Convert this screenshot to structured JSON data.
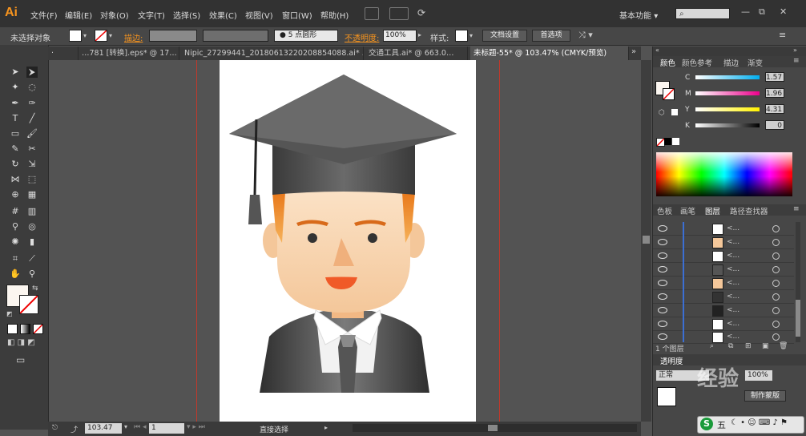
{
  "app": {
    "logo": "Ai"
  },
  "menu": [
    "文件(F)",
    "编辑(E)",
    "对象(O)",
    "文字(T)",
    "选择(S)",
    "效果(C)",
    "视图(V)",
    "窗口(W)",
    "帮助(H)"
  ],
  "workspace": {
    "label": "基本功能",
    "chevron": "▾"
  },
  "search": {
    "placeholder": ""
  },
  "window": {
    "minimize": "—",
    "restore": "⧉",
    "close": "✕"
  },
  "control": {
    "no_selection": "未选择对象",
    "stroke_label": "描边:",
    "stroke_weight": "",
    "brush": "5 点圆形",
    "opacity_label": "不透明度:",
    "opacity_value": "100%",
    "style_label": "样式:",
    "doc_setup": "文档设置",
    "preferences": "首选项"
  },
  "tabs": [
    {
      "label": "…781 [转换].eps* @ 17…"
    },
    {
      "label": "Nipic_27299441_20180613220208854088.ai* …"
    },
    {
      "label": "交通工具.ai* @ 663.0…"
    },
    {
      "label": "未标题-55* @ 103.47% (CMYK/预览)",
      "active": true
    }
  ],
  "tabs_overflow": "»",
  "status": {
    "zoom": "103.47",
    "page": "1",
    "tool": "直接选择"
  },
  "color_panel": {
    "tabs": [
      "颜色",
      "颜色参考",
      "描边",
      "渐变"
    ],
    "channels": [
      {
        "name": "C",
        "value": "1.57",
        "color": "#00aeef"
      },
      {
        "name": "M",
        "value": "1.96",
        "color": "#ec008c"
      },
      {
        "name": "Y",
        "value": "4.31",
        "color": "#fff200"
      },
      {
        "name": "K",
        "value": "0",
        "color": "#000000"
      }
    ]
  },
  "layers_panel": {
    "tabs": [
      "色板",
      "画笔",
      "图层",
      "路径查找器"
    ],
    "active_tab": "图层",
    "rows": [
      "<...",
      "<...",
      "<...",
      "<...",
      "<...",
      "<...",
      "<...",
      "<...",
      "<..."
    ],
    "footer": "1 个图层"
  },
  "transparency": {
    "label": "透明度",
    "opacity": "100%",
    "blend": "正常",
    "make_mask": "制作蒙版"
  },
  "ime": {
    "s": "S",
    "mode": "五"
  },
  "watermark": "经验",
  "colors": {
    "accent": "#f7941e",
    "guide": "#c0392b",
    "fill": "#fbf6f0"
  }
}
